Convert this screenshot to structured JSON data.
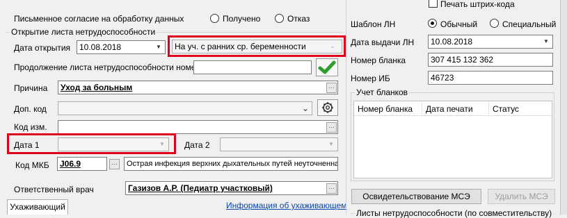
{
  "consent": {
    "label": "Письменное согласие на обработку данных",
    "option_received": "Получено",
    "option_refused": "Отказ"
  },
  "opening": {
    "group_title": "Открытие листа нетрудоспособности",
    "date_label": "Дата открытия",
    "date_value": "10.08.2018",
    "status_value": "На уч. с ранних ср. беременности"
  },
  "continuation": {
    "label": "Продолжение листа нетрудоспособности номер",
    "value": ""
  },
  "reason": {
    "label": "Причина",
    "value": "Уход за больным"
  },
  "extra_code": {
    "label": "Доп. код",
    "value": ""
  },
  "code_change": {
    "label": "Код изм.",
    "value": ""
  },
  "date1": {
    "label": "Дата 1",
    "value": ""
  },
  "date2": {
    "label": "Дата 2",
    "value": ""
  },
  "mkb": {
    "label": "Код МКБ",
    "code": "J06.9",
    "description": "Острая инфекция верхних дыхательных путей неуточненна"
  },
  "doctor": {
    "label": "Ответственный врач",
    "value": "Газизов А.Р. (Педиатр участковый)"
  },
  "tabs": {
    "caregiver_tab": "Ухаживающий",
    "caregiver_info_link": "Информация об ухаживающем"
  },
  "right": {
    "print_barcode": "Печать штрих-кода",
    "template_label": "Шаблон ЛН",
    "template_normal": "Обычный",
    "template_special": "Специальный",
    "issue_date_label": "Дата выдачи ЛН",
    "issue_date_value": "10.08.2018",
    "form_number_label": "Номер бланка",
    "form_number_value": "307 415 132 362",
    "ib_number_label": "Номер ИБ",
    "ib_number_value": "46723",
    "forms_group_title": "Учет бланков",
    "forms_table_headers": [
      "Номер бланка",
      "Дата печати",
      "Статус"
    ],
    "mse_button": "Освидетельствование МСЭ",
    "delete_mse_button": "Удалить МСЭ",
    "combined_sheets": "Листы нетрудоспособности (по совместительству)"
  },
  "colors": {
    "highlight": "#e0001b",
    "window_bg": "#f0f0f0",
    "confirm_green": "#2e9e2e"
  }
}
